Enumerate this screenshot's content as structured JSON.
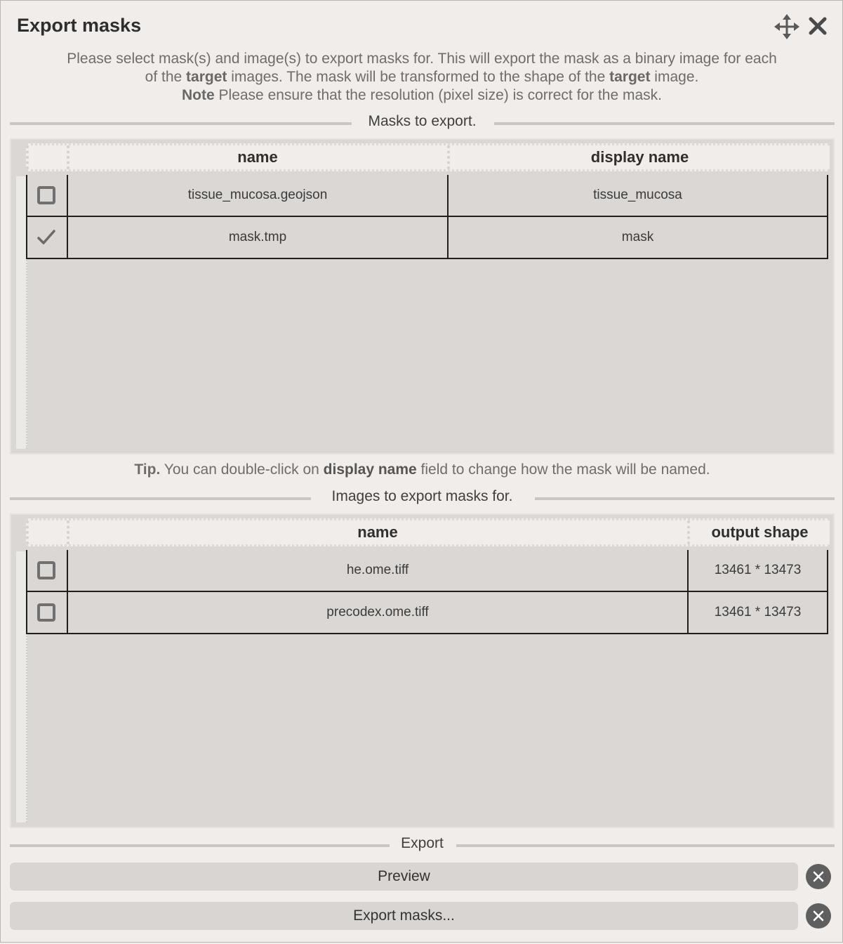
{
  "dialog": {
    "title": "Export masks",
    "description_line1": "Please select mask(s) and image(s) to export masks for. This will export the mask as a binary image for each",
    "description_line2_a": "of the ",
    "description_line2_b": "target",
    "description_line2_c": " images. The mask will be transformed to the shape of the ",
    "description_line2_d": "target",
    "description_line2_e": " image.",
    "note_label": "Note",
    "note_text": " Please ensure that the resolution (pixel size) is correct for the mask."
  },
  "masks_section": {
    "title": "Masks to export.",
    "columns": [
      "name",
      "display name"
    ],
    "rows": [
      {
        "checked": false,
        "name": "tissue_mucosa.geojson",
        "display_name": "tissue_mucosa"
      },
      {
        "checked": true,
        "name": "mask.tmp",
        "display_name": "mask"
      }
    ]
  },
  "tip": {
    "label": "Tip.",
    "text_a": " You can double-click on ",
    "text_bold": "display name",
    "text_b": " field to change how the mask will be named."
  },
  "images_section": {
    "title": "Images to export masks for.",
    "columns": [
      "name",
      "output shape"
    ],
    "rows": [
      {
        "checked": false,
        "name": "he.ome.tiff",
        "output_shape": "13461 * 13473"
      },
      {
        "checked": false,
        "name": "precodex.ome.tiff",
        "output_shape": "13461 * 13473"
      }
    ]
  },
  "export_section": {
    "title": "Export",
    "preview_label": "Preview",
    "export_label": "Export masks..."
  },
  "icons": {
    "move": "move-arrows-icon",
    "close": "close-icon",
    "check": "checkmark-icon",
    "cancel": "circle-x-icon"
  }
}
